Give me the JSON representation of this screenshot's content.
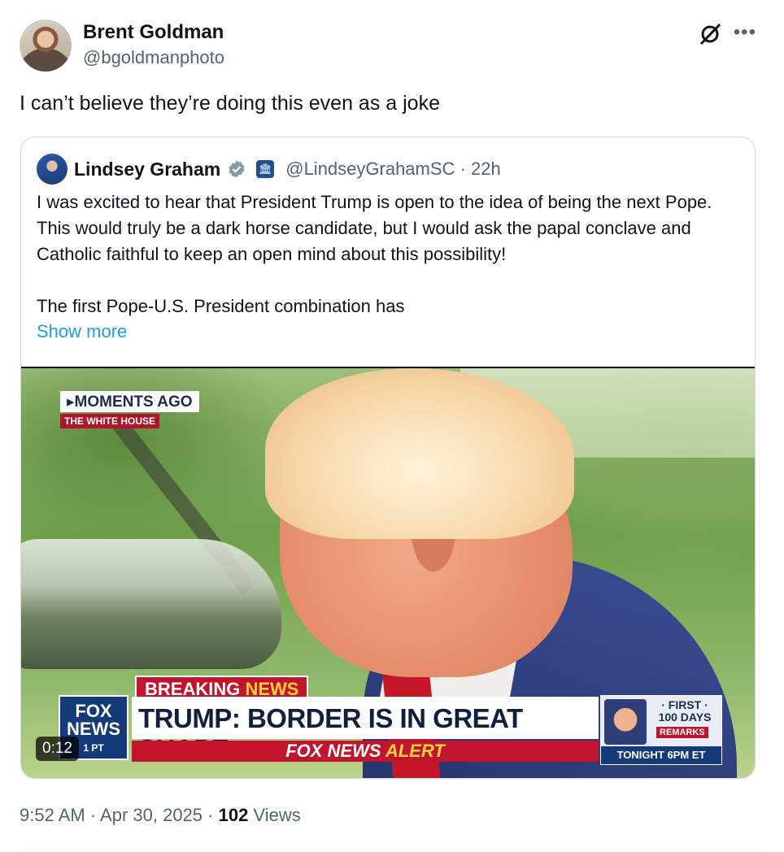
{
  "tweet": {
    "author_name": "Brent Goldman",
    "author_handle": "@bgoldmanphoto",
    "text": "I can’t believe they’re doing this even as a joke",
    "more_icon": "more-icon",
    "grok_icon": "grok-icon"
  },
  "quote": {
    "author_name": "Lindsey Graham",
    "verified_icon": "verified-badge-icon",
    "affiliation_icon": "government-building-icon",
    "handle_time": "@LindseyGrahamSC · 22h",
    "paragraph1": "I was excited to hear that President Trump is open to the idea of being the next Pope. This would truly be a dark horse candidate, but I would ask the papal conclave and Catholic faithful to keep an open mind about this possibility!",
    "paragraph2": "The first Pope-U.S. President combination has",
    "show_more": "Show more"
  },
  "video": {
    "duration": "0:12",
    "overlay": {
      "moments_ago": "MOMENTS AGO",
      "location": "THE WHITE HOUSE",
      "breaking_a": "BREAKING ",
      "breaking_b": "NEWS",
      "headline": "TRUMP: BORDER IS IN GREAT SHAPE",
      "alert_a": "FOX NEWS ",
      "alert_b": "ALERT",
      "fox_top": "FOX",
      "fox_bottom": "NEWS",
      "fox_time": "1 PT",
      "promo_first": "· FIRST ·",
      "promo_days": "100 DAYS",
      "promo_remarks": "REMARKS",
      "promo_tonight": "TONIGHT 6PM ET"
    }
  },
  "meta": {
    "time_date": "9:52 AM · Apr 30, 2025 · ",
    "views_count": "102",
    "views_label": " Views"
  }
}
